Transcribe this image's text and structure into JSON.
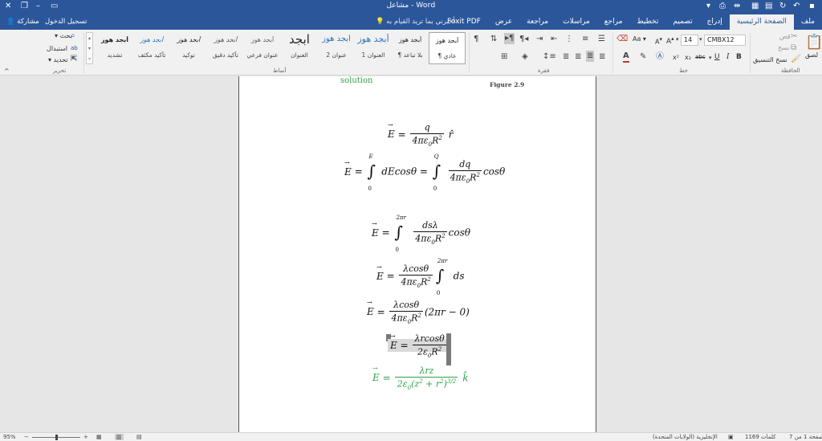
{
  "window": {
    "title": "مشاعل - Word"
  },
  "tabs": [
    "ملف",
    "الصفحة الرئيسية",
    "إدراج",
    "تصميم",
    "تخطيط",
    "مراجع",
    "مراسلات",
    "مراجعة",
    "عرض",
    "Foxit PDF"
  ],
  "active_tab": "الصفحة الرئيسية",
  "tell_me": "أخبرني بما تريد القيام به...",
  "sign_in": "تسجيل الدخول",
  "share": "مشاركة",
  "ribbon": {
    "clipboard": {
      "label": "الحافظة",
      "paste": "لصق",
      "cut": "قص",
      "copy": "نسخ",
      "format_painter": "نسخ التنسيق"
    },
    "font": {
      "label": "خط",
      "font_name": "CMBX12",
      "font_size": "14",
      "bold": "B",
      "italic": "I",
      "underline": "U",
      "strike": "abc",
      "subscript": "x₂",
      "superscript": "x²",
      "grow": "A",
      "shrink": "A",
      "case": "Aa"
    },
    "paragraph": {
      "label": "فقرة"
    },
    "styles": {
      "label": "أنماط",
      "items": [
        {
          "preview": "أبجد هوز",
          "name": "¶ عادي"
        },
        {
          "preview": "أبجد هوز",
          "name": "¶ بلا تباعد"
        },
        {
          "preview": "أبجد هوز",
          "name": "العنوان 1"
        },
        {
          "preview": "أبجد هوز",
          "name": "عنوان 2"
        },
        {
          "preview": "ابجد",
          "name": "العنوان"
        },
        {
          "preview": "أبجد هوز",
          "name": "عنوان فرعي"
        },
        {
          "preview": "أبجد هوز",
          "name": "تأكيد دقيق"
        },
        {
          "preview": "أبجد هوز",
          "name": "توكيد"
        },
        {
          "preview": "أبجد هوز",
          "name": "تأكيد مكثف"
        },
        {
          "preview": "أبجد هوز",
          "name": "تشديد"
        }
      ]
    },
    "editing": {
      "label": "تحرير",
      "find": "بحث",
      "replace": "استبدال",
      "select": "تحديد"
    }
  },
  "document": {
    "solution_label": "solution",
    "figure_caption": "Figure 2.9"
  },
  "status": {
    "page": "الصفحة 1 من 7",
    "words": "1169 كلمات",
    "language": "الإنجليزية (الولايات المتحدة)",
    "zoom": "95%"
  },
  "colors": {
    "ribbon_blue": "#2b579a",
    "green_text": "#2ea043"
  }
}
